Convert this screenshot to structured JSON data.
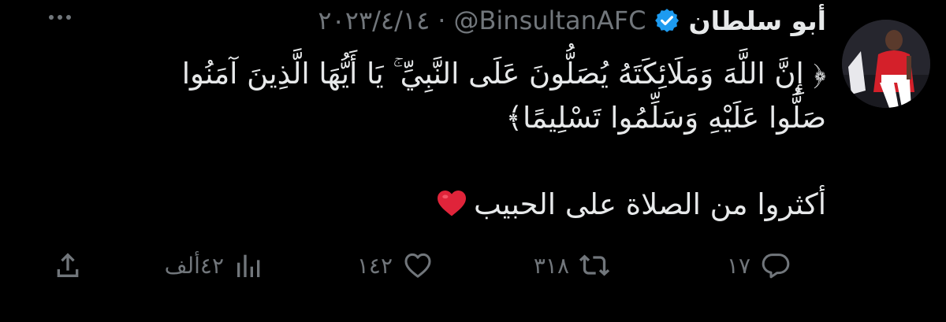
{
  "tweet": {
    "display_name": "أبو سلطان",
    "handle": "@BinsultanAFC",
    "separator": "·",
    "date": "٢٠٢٣/٤/١٤",
    "verified_icon": "verified-badge-icon",
    "more_icon": "more-options-icon",
    "text_line1": "﴿ إِنَّ اللَّهَ وَمَلَائِكَتَهُ يُصَلُّونَ عَلَى النَّبِيِّ ۚ يَا أَيُّهَا الَّذِينَ آمَنُوا",
    "text_line2": "صَلُّوا عَلَيْهِ وَسَلِّمُوا تَسْلِيمًا﴾",
    "text_line3": "أكثروا من الصلاة على الحبيب",
    "emoji": "red-heart",
    "accent_color": "#1d9bf0",
    "text_color": "#e7e9ea",
    "muted_color": "#71767b"
  },
  "actions": {
    "reply_count": "١٧",
    "retweet_count": "٣١٨",
    "like_count": "١٤٢",
    "views_count": "٤٢ألف",
    "reply_icon": "reply-icon",
    "retweet_icon": "retweet-icon",
    "like_icon": "heart-icon",
    "views_icon": "views-chart-icon",
    "share_icon": "share-icon"
  }
}
